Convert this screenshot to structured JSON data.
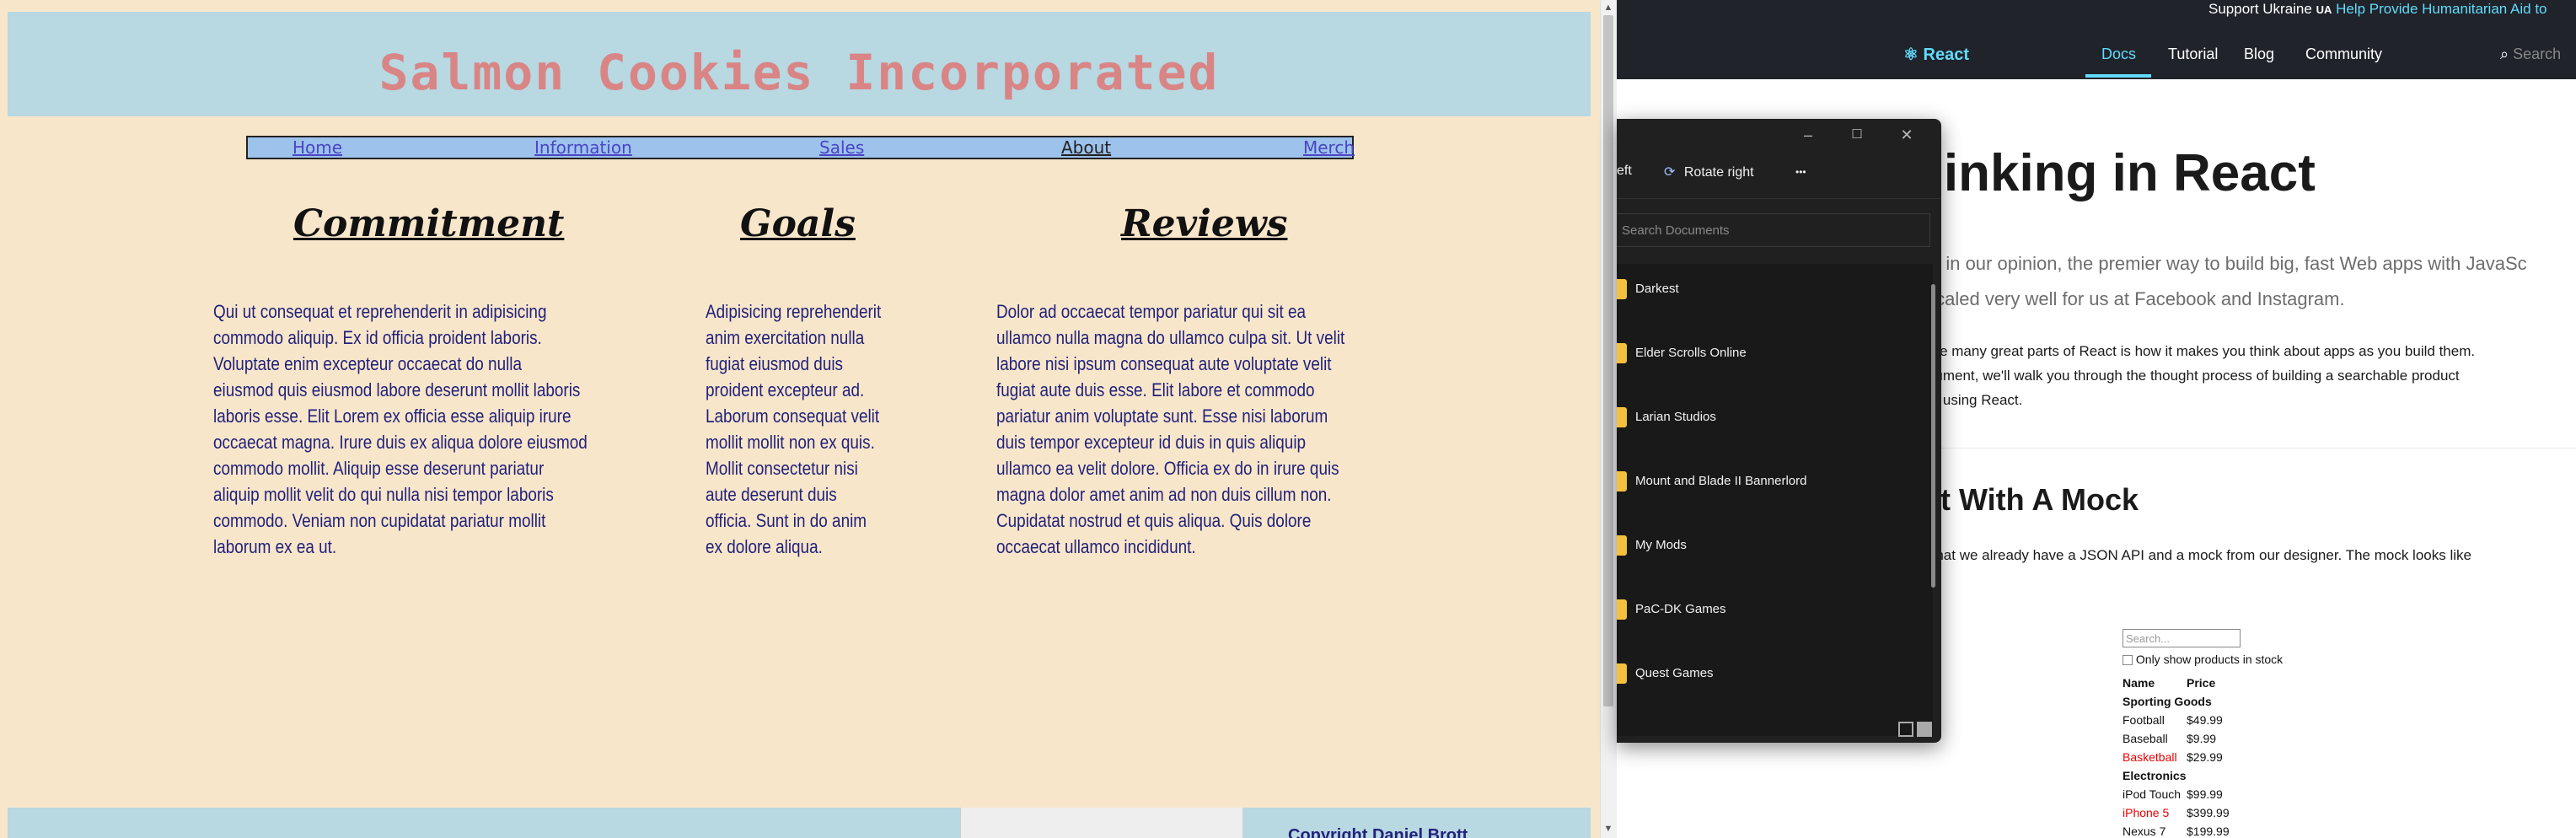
{
  "left_site": {
    "title": "Salmon Cookies Incorporated",
    "nav": [
      "Home",
      "Information",
      "Sales",
      "About",
      "Merch"
    ],
    "columns": [
      {
        "heading": "Commitment",
        "lines": [
          "Qui ut consequat et reprehenderit in adipisicing",
          "commodo aliquip. Ex id officia proident laboris.",
          "Voluptate enim excepteur occaecat do nulla",
          "eiusmod quis eiusmod labore deserunt mollit laboris",
          "laboris esse. Elit Lorem ex officia esse aliquip irure",
          "occaecat magna. Irure duis ex aliqua dolore eiusmod",
          "commodo mollit. Aliquip esse deserunt pariatur",
          "aliquip mollit velit do qui nulla nisi tempor laboris",
          "commodo. Veniam non cupidatat pariatur mollit",
          "laborum ex ea ut."
        ]
      },
      {
        "heading": "Goals",
        "lines": [
          "Adipisicing reprehenderit",
          "anim exercitation nulla",
          "fugiat eiusmod duis",
          "proident excepteur ad.",
          "Laborum consequat velit",
          "mollit mollit non ex quis.",
          "Mollit consectetur nisi",
          "aute deserunt duis",
          "officia. Sunt in do anim",
          "ex dolore aliqua."
        ]
      },
      {
        "heading": "Reviews",
        "lines": [
          "Dolor ad occaecat tempor pariatur qui sit ea",
          "ullamco nulla magna do ullamco culpa sit. Ut velit",
          "labore nisi ipsum consequat aute voluptate velit",
          "fugiat aute duis esse. Elit labore et commodo",
          "pariatur anim voluptate sunt. Esse nisi laborum",
          "duis tempor excepteur id duis in quis aliquip",
          "ullamco ea velit dolore. Officia ex do in irure quis",
          "magna dolor amet anim ad non duis cillum non.",
          "Cupidatat nostrud et quis aliqua. Quis dolore",
          "occaecat ullamco incididunt."
        ]
      }
    ],
    "footer_copyright": "Copyright Daniel Brott"
  },
  "react_docs": {
    "banner_text": "Support Ukraine",
    "banner_flag": "UA",
    "banner_link": "Help Provide Humanitarian Aid to",
    "logo": "React",
    "nav": [
      "Docs",
      "Tutorial",
      "Blog",
      "Community"
    ],
    "search_placeholder": "Search",
    "h1": "hinking in React",
    "lead_lines": [
      "t is, in our opinion, the premier way to build big, fast Web apps with JavaSc",
      "s scaled very well for us at Facebook and Instagram."
    ],
    "para1_lines": [
      "of the many great parts of React is how it makes you think about apps as you build them.",
      " document, we'll walk you through the thought process of building a searchable product",
      "able using React."
    ],
    "h2": "art With A Mock",
    "para2": "ne that we already have a JSON API and a mock from our designer. The mock looks like",
    "mock": {
      "search_placeholder": "Search...",
      "checkbox_label": "Only show products in stock",
      "header_name": "Name",
      "header_price": "Price",
      "rows": [
        {
          "name": "Sporting Goods",
          "price": "",
          "kind": "category"
        },
        {
          "name": "Football",
          "price": "$49.99",
          "kind": "item"
        },
        {
          "name": "Baseball",
          "price": "$9.99",
          "kind": "item"
        },
        {
          "name": "Basketball",
          "price": "$29.99",
          "kind": "out"
        },
        {
          "name": "Electronics",
          "price": "",
          "kind": "category"
        },
        {
          "name": "iPod Touch",
          "price": "$99.99",
          "kind": "item"
        },
        {
          "name": "iPhone 5",
          "price": "$399.99",
          "kind": "out"
        },
        {
          "name": "Nexus 7",
          "price": "$199.99",
          "kind": "item"
        }
      ]
    }
  },
  "file_picker": {
    "toolbar": {
      "rotate_left_partial": "eft",
      "rotate_right": "Rotate right",
      "more": "•••"
    },
    "search_placeholder": "Search Documents",
    "folders": [
      "Darkest",
      "Elder Scrolls Online",
      "Larian Studios",
      "Mount and Blade II Bannerlord",
      "My Mods",
      "PaC-DK Games",
      "Quest Games"
    ]
  },
  "colors": {
    "header_bg": "#b8d8e2",
    "page_bg": "#f8e6cb",
    "title": "#d98585",
    "nav_bg": "#9dc2ec",
    "react_dark": "#20232a",
    "react_accent": "#61dafb",
    "folder": "#f4c03f"
  }
}
